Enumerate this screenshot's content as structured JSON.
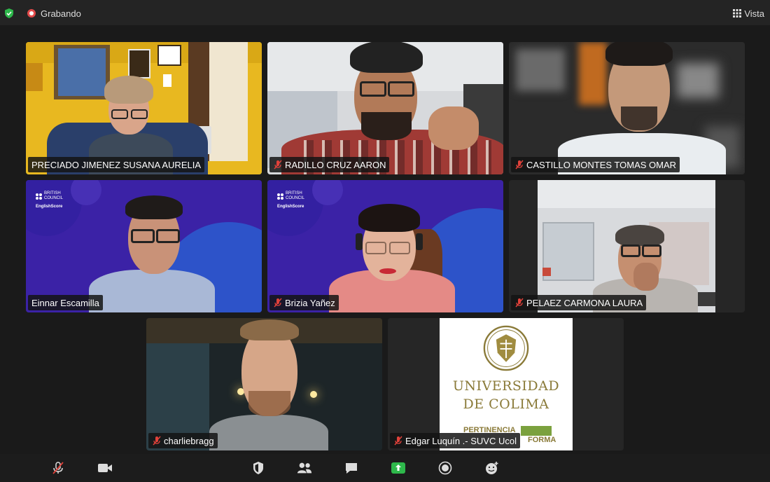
{
  "topbar": {
    "recording_label": "Grabando",
    "view_label": "Vista"
  },
  "participants": [
    {
      "name": "PRECIADO JIMENEZ SUSANA AURELIA",
      "muted": false,
      "active_speaker": true
    },
    {
      "name": "RADILLO CRUZ AARON",
      "muted": true
    },
    {
      "name": "CASTILLO MONTES TOMAS OMAR",
      "muted": true
    },
    {
      "name": "Einnar Escamilla",
      "muted": false
    },
    {
      "name": "Brizia Yañez",
      "muted": true
    },
    {
      "name": "PELAEZ CARMONA LAURA",
      "muted": true
    },
    {
      "name": "charliebragg",
      "muted": true
    },
    {
      "name": "Edgar Luquín .- SUVC Ucol",
      "muted": true
    }
  ],
  "backgrounds": {
    "british_council_line1": "BRITISH",
    "british_council_line2": "COUNCIL",
    "englishscore": "EnglishScore"
  },
  "ucol_logo": {
    "line1": "UNIVERSIDAD",
    "line2": "DE COLIMA",
    "footer_left": "PERTINENCIA",
    "footer_right": "FORMA"
  },
  "colors": {
    "active_speaker_border": "#7be06a",
    "recording_red": "#e24a4a",
    "share_green": "#2eb84b",
    "mute_red": "#e0413a",
    "bc_purple": "#3b22a6"
  },
  "bottombar_icons": [
    "mic-muted-icon",
    "video-icon",
    "security-icon",
    "participants-icon",
    "chat-icon",
    "share-screen-icon",
    "record-icon",
    "reactions-icon"
  ]
}
